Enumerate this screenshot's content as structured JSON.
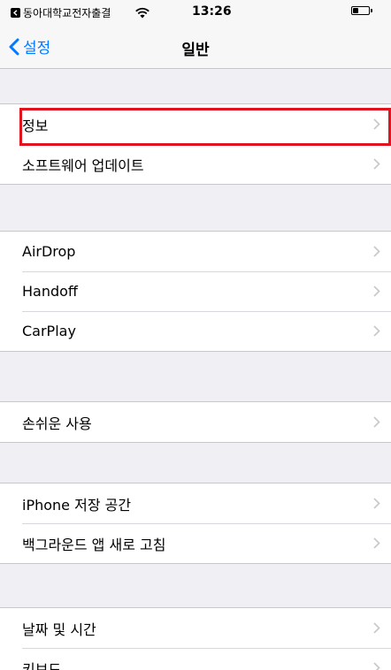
{
  "status_bar": {
    "back_app_label": "동아대학교전자출결",
    "time": "13:26",
    "icons": [
      "back-app-icon",
      "wifi-icon",
      "battery-icon"
    ]
  },
  "nav": {
    "back_label": "설정",
    "title": "일반"
  },
  "sections": [
    {
      "items": [
        {
          "label": "정보"
        },
        {
          "label": "소프트웨어 업데이트"
        }
      ]
    },
    {
      "items": [
        {
          "label": "AirDrop"
        },
        {
          "label": "Handoff"
        },
        {
          "label": "CarPlay"
        }
      ]
    },
    {
      "items": [
        {
          "label": "손쉬운 사용"
        }
      ]
    },
    {
      "items": [
        {
          "label": "iPhone 저장 공간"
        },
        {
          "label": "백그라운드 앱 새로 고침"
        }
      ]
    },
    {
      "items": [
        {
          "label": "날짜 및 시간"
        },
        {
          "label": "키보드"
        }
      ]
    }
  ],
  "colors": {
    "accent": "#007aff",
    "highlight": "#e0141e",
    "background": "#efeff4"
  }
}
